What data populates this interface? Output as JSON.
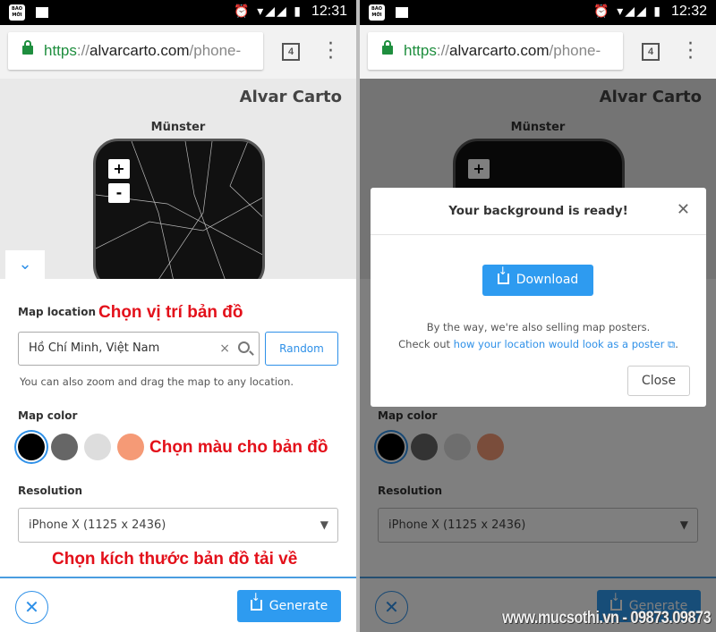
{
  "status": {
    "app_icon": "BÁO MỚI",
    "icons": [
      "alarm-icon",
      "data-icon",
      "wifi-icon",
      "signal-icon",
      "battery-icon"
    ],
    "time_left": "12:31",
    "time_right": "12:32"
  },
  "browser": {
    "scheme": "https",
    "sep": "://",
    "host": "alvarcarto.com",
    "path": "/phone-",
    "tab_count": "4"
  },
  "site": {
    "brand": "Alvar Carto",
    "city": "Münster",
    "zoom_in": "+",
    "zoom_out": "-"
  },
  "form": {
    "map_location_label": "Map location",
    "location_value": "Hồ Chí Minh, Việt Nam",
    "clear": "×",
    "random": "Random",
    "help": "You can also zoom and drag the map to any location.",
    "map_color_label": "Map color",
    "colors": [
      "#000000",
      "#666666",
      "#dddddd",
      "#f59a76"
    ],
    "selected_color": 0,
    "resolution_label": "Resolution",
    "resolution_value": "iPhone X (1125 x 2436)",
    "generate": "Generate"
  },
  "annotations": {
    "location": "Chọn vị trí bản đồ",
    "color": "Chọn màu cho bản đồ",
    "size": "Chọn kích thước bản đồ tải về"
  },
  "modal": {
    "title": "Your background is ready!",
    "download": "Download",
    "line1": "By the way, we're also selling map posters.",
    "line2_prefix": "Check out ",
    "link": "how your location would look as a poster",
    "line2_suffix": ".",
    "close": "Close"
  },
  "watermark": "www.mucsothi.vn - 09873.09873",
  "colors": {
    "accent": "#2e9bf0",
    "annotation": "#e3101a"
  }
}
